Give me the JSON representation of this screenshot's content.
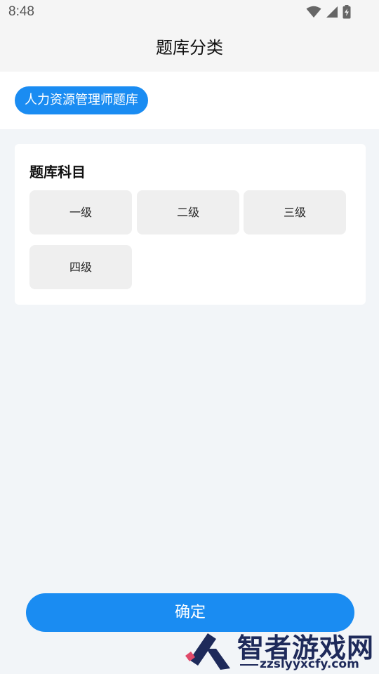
{
  "status_bar": {
    "time": "8:48",
    "icons": [
      "wifi-icon",
      "signal-icon",
      "battery-charging-icon"
    ]
  },
  "header": {
    "title": "题库分类"
  },
  "category": {
    "selected": "人力资源管理师题库",
    "accent_color": "#1a8cf2"
  },
  "subjects": {
    "title": "题库科目",
    "items": [
      {
        "label": "一级"
      },
      {
        "label": "二级"
      },
      {
        "label": "三级"
      },
      {
        "label": "四级"
      }
    ]
  },
  "footer": {
    "confirm_label": "确定"
  },
  "watermark": {
    "brand": "智者游戏网",
    "url": "zzslyyxcfy.com"
  }
}
